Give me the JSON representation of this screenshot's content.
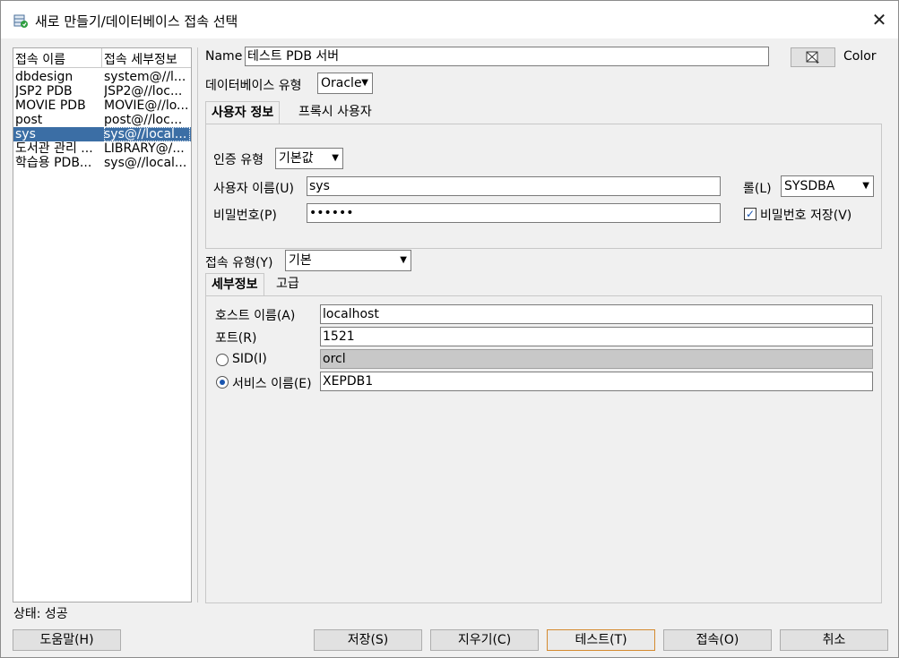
{
  "window": {
    "title": "새로 만들기/데이터베이스 접속 선택"
  },
  "connections": {
    "header": {
      "name": "접속 이름",
      "details": "접속 세부정보"
    },
    "rows": [
      {
        "name": "dbdesign",
        "details": "system@//l..."
      },
      {
        "name": "JSP2 PDB",
        "details": "JSP2@//loc..."
      },
      {
        "name": "MOVIE PDB",
        "details": "MOVIE@//lo..."
      },
      {
        "name": "post",
        "details": "post@//loc..."
      },
      {
        "name": "sys",
        "details": "sys@//local..."
      },
      {
        "name": "도서관 관리 ...",
        "details": "LIBRARY@/..."
      },
      {
        "name": "학습용 PDB...",
        "details": "sys@//local..."
      }
    ],
    "selected_index": 4
  },
  "status": "상태: 성공",
  "form": {
    "name_label": "Name",
    "name_value": "테스트 PDB 서버",
    "color_label": "Color",
    "db_type_label": "데이터베이스 유형",
    "db_type_value": "Oracle",
    "tabs1": [
      "사용자 정보",
      "프록시 사용자"
    ],
    "auth_type_label": "인증 유형",
    "auth_type_value": "기본값",
    "user_label": "사용자 이름(U)",
    "user_value": "sys",
    "role_label": "롤(L)",
    "role_value": "SYSDBA",
    "password_label": "비밀번호(P)",
    "password_value": "••••••",
    "save_password_label": "비밀번호 저장(V)",
    "save_password_checked": true,
    "conn_type_label": "접속 유형(Y)",
    "conn_type_value": "기본",
    "tabs2": [
      "세부정보",
      "고급"
    ],
    "host_label": "호스트 이름(A)",
    "host_value": "localhost",
    "port_label": "포트(R)",
    "port_value": "1521",
    "sid_label": "SID(I)",
    "sid_value": "orcl",
    "service_label": "서비스 이름(E)",
    "service_value": "XEPDB1",
    "service_selected": true
  },
  "buttons": {
    "help": "도움말(H)",
    "save": "저장(S)",
    "clear": "지우기(C)",
    "test": "테스트(T)",
    "connect": "접속(O)",
    "cancel": "취소"
  }
}
